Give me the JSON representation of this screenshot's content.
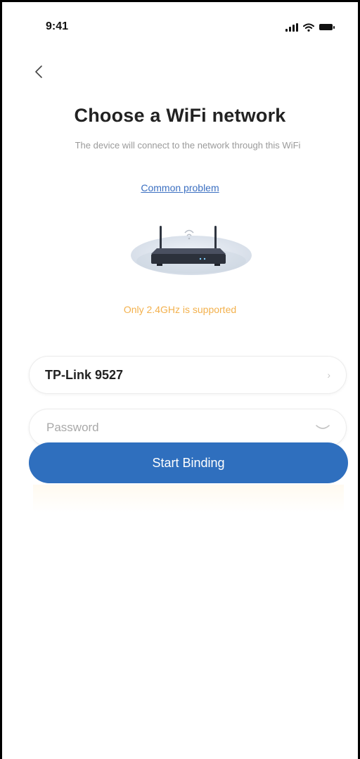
{
  "status_bar": {
    "time": "9:41",
    "icons": [
      "signal-icon",
      "wifi-icon",
      "battery-icon"
    ]
  },
  "nav": {
    "back_icon": "chevron-left-icon"
  },
  "header": {
    "title": "Choose a WiFi network",
    "subtitle": "The device will connect to the network through this WiFi",
    "link_label": "Common problem"
  },
  "illustration": {
    "icon": "router-icon"
  },
  "hint": "Only 2.4GHz is supported",
  "form": {
    "network_name": "TP-Link 9527",
    "network_chevron": "chevron-right-icon",
    "password_placeholder": "Password",
    "password_value": "",
    "password_toggle_icon": "eye-closed-icon",
    "submit_label": "Start Binding"
  },
  "colors": {
    "primary": "#2f6fbe",
    "link": "#3b6fc1",
    "hint": "#f3b14d",
    "title": "#222222",
    "subtitle": "#9a9a9a"
  }
}
